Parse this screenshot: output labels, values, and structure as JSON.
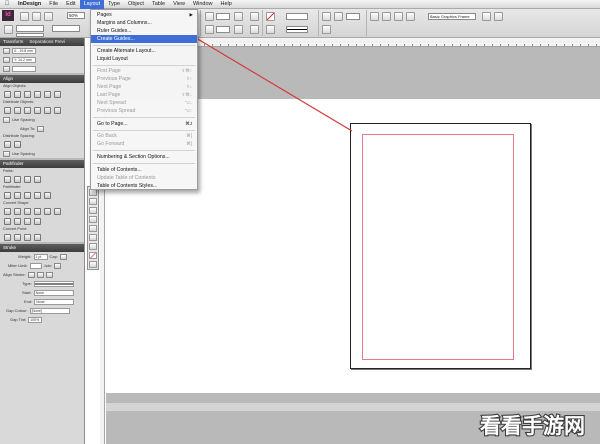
{
  "menubar": {
    "apple": "",
    "items": [
      "InDesign",
      "File",
      "Edit",
      "Layout",
      "Type",
      "Object",
      "Table",
      "View",
      "Window",
      "Help"
    ],
    "active_index": 3
  },
  "controlbar": {
    "logo": "Id",
    "zoom": "50%",
    "font_field": "Basic Graphics Frame"
  },
  "panels": {
    "transform": {
      "tabs": [
        "Transform",
        "Separations Previ"
      ],
      "x": "X: -19.8 mm",
      "y": "Y: 14.2 mm"
    },
    "align": {
      "tab": "Align",
      "align_objects": "Align Objects:",
      "distribute_objects": "Distribute Objects:",
      "use_spacing": "Use Spacing",
      "align_to": "Align To:",
      "distribute_spacing": "Distribute Spacing:"
    },
    "pathfinder": {
      "tab": "Pathfinder",
      "paths": "Paths:",
      "pathfinder": "Pathfinder:",
      "convert_shape": "Convert Shape:",
      "convert_point": "Convert Point:"
    },
    "stroke": {
      "tab": "Stroke",
      "weight": "Weight:",
      "weight_val": "1 pt",
      "cap": "Cap:",
      "miter_limit": "Miter Limit:",
      "join": "Join:",
      "align_stroke": "Align Stroke:",
      "type": "Type:",
      "start": "Start:",
      "start_val": "None",
      "end": "End:",
      "end_val": "None",
      "gap_colour": "Gap Colour:",
      "gap_colour_val": "[None]",
      "gap_tint": "Gap Tint:",
      "gap_tint_val": "100%"
    }
  },
  "layout_menu": {
    "items": [
      {
        "label": "Pages",
        "shortcut": "",
        "submenu": true,
        "disabled": false
      },
      {
        "label": "Margins and Columns...",
        "shortcut": "",
        "submenu": false,
        "disabled": false
      },
      {
        "label": "Ruler Guides...",
        "shortcut": "",
        "submenu": false,
        "disabled": false
      },
      {
        "label": "Create Guides...",
        "shortcut": "",
        "submenu": false,
        "disabled": false,
        "highlight": true
      },
      {
        "label": "Create Alternate Layout...",
        "shortcut": "",
        "submenu": false,
        "disabled": false
      },
      {
        "label": "Liquid Layout",
        "shortcut": "",
        "submenu": false,
        "disabled": false
      },
      {
        "label": "First Page",
        "shortcut": "⇧⌘↑",
        "submenu": false,
        "disabled": true
      },
      {
        "label": "Previous Page",
        "shortcut": "⇧↑",
        "submenu": false,
        "disabled": true
      },
      {
        "label": "Next Page",
        "shortcut": "⇧↓",
        "submenu": false,
        "disabled": true
      },
      {
        "label": "Last Page",
        "shortcut": "⇧⌘↓",
        "submenu": false,
        "disabled": true
      },
      {
        "label": "Next Spread",
        "shortcut": "⌥↓",
        "submenu": false,
        "disabled": true
      },
      {
        "label": "Previous Spread",
        "shortcut": "⌥↑",
        "submenu": false,
        "disabled": true
      },
      {
        "label": "Go to Page...",
        "shortcut": "⌘J",
        "submenu": false,
        "disabled": false
      },
      {
        "label": "Go Back",
        "shortcut": "⌘[",
        "submenu": false,
        "disabled": true
      },
      {
        "label": "Go Forward",
        "shortcut": "⌘]",
        "submenu": false,
        "disabled": true
      },
      {
        "label": "Numbering & Section Options...",
        "shortcut": "",
        "submenu": false,
        "disabled": false
      },
      {
        "label": "Table of Contents...",
        "shortcut": "",
        "submenu": false,
        "disabled": false
      },
      {
        "label": "Update Table of Contents",
        "shortcut": "",
        "submenu": false,
        "disabled": true
      },
      {
        "label": "Table of Contents Styles...",
        "shortcut": "",
        "submenu": false,
        "disabled": false
      }
    ]
  },
  "colors": {
    "highlight": "#3f6fd6",
    "annotation_line": "#d23a3a",
    "margin_guide": "#e37b88",
    "pasteboard": "#b9b9b9"
  },
  "watermark": {
    "text": "看看手游网"
  }
}
